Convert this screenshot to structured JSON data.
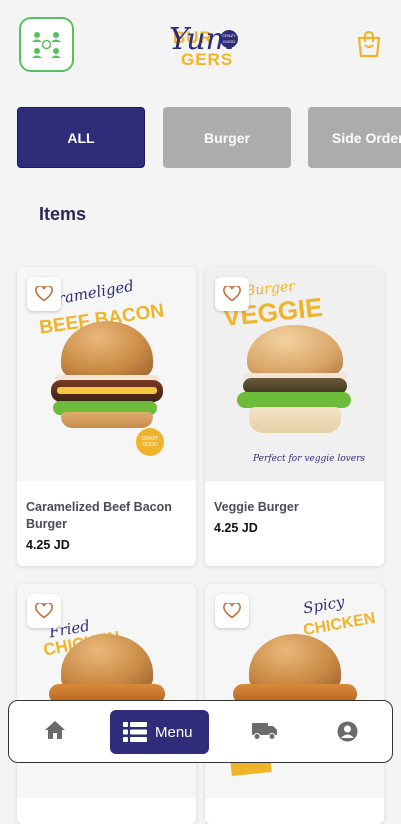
{
  "header": {
    "logo": {
      "top": "BUR",
      "bottom": "GERS",
      "script": "Yum",
      "badge": "CRAZY GOOD"
    },
    "icons": {
      "group": "group-icon",
      "cart": "shopping-bag-icon"
    }
  },
  "categories": [
    {
      "label": "ALL",
      "active": true
    },
    {
      "label": "Burger",
      "active": false
    },
    {
      "label": "Side Order",
      "active": false
    }
  ],
  "section_title": "Items",
  "items": [
    {
      "name": "Caramelized Beef Bacon Burger",
      "price": "4.25 JD",
      "img_script": "Carameliged",
      "img_big": "BEEF BACON",
      "img_badge": "CRAZY GOOD"
    },
    {
      "name": "Veggie Burger",
      "price": "4.25 JD",
      "img_script": "Burger",
      "img_big": "VEGGIE",
      "img_caption": "Perfect for veggie lovers"
    },
    {
      "name": "",
      "price": "",
      "img_script": "Fried",
      "img_big": "CHICKEN"
    },
    {
      "name": "",
      "price": "",
      "img_script": "Spicy",
      "img_big": "CHICKEN"
    }
  ],
  "bottom_nav": {
    "home": "home-icon",
    "menu_label": "Menu",
    "delivery": "truck-icon",
    "profile": "user-icon"
  },
  "colors": {
    "primary": "#2f2d7a",
    "accent": "#f0b428",
    "inactive": "#acacac",
    "fav": "#c0703a",
    "group_border": "#56c25b"
  }
}
